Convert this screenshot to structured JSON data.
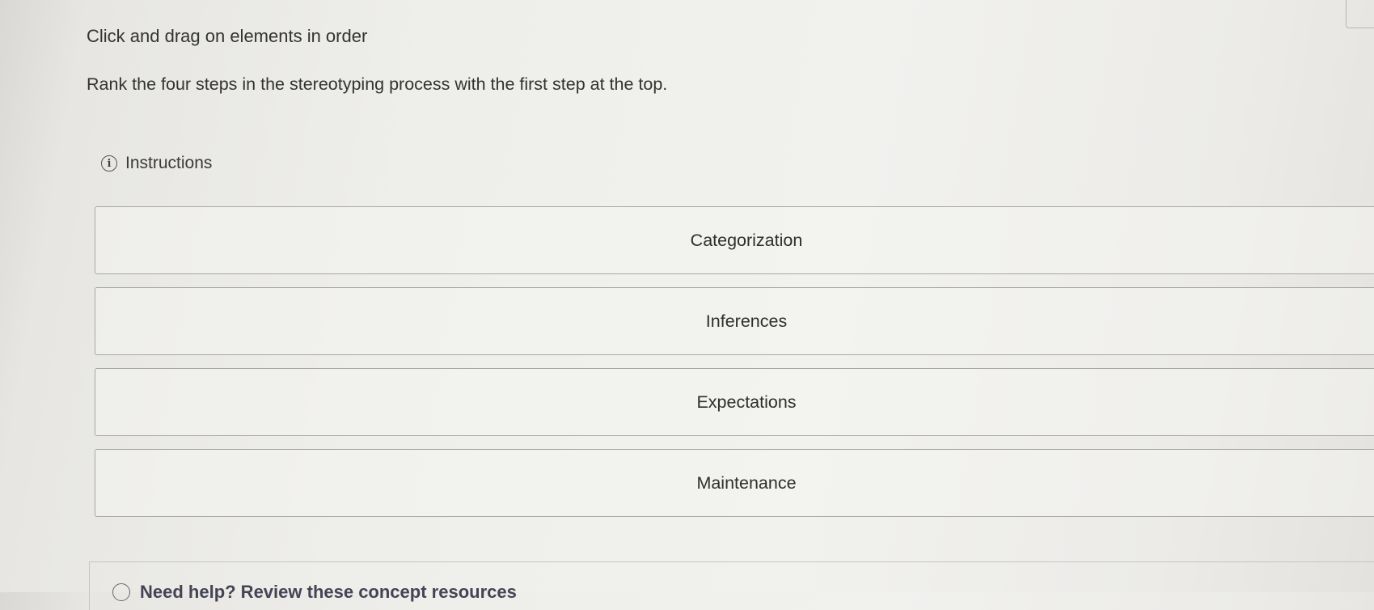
{
  "header": {
    "prompt": "Click and drag on elements in order",
    "question": "Rank the four steps in the stereotyping process with the first step at the top."
  },
  "instructions": {
    "label": "Instructions",
    "icon": "info-icon"
  },
  "rank_items": [
    {
      "label": "Categorization"
    },
    {
      "label": "Inferences"
    },
    {
      "label": "Expectations"
    },
    {
      "label": "Maintenance"
    }
  ],
  "help": {
    "label": "Need help? Review these concept resources"
  },
  "colors": {
    "border": "#a7a7a4",
    "text": "#2e2e2e"
  }
}
